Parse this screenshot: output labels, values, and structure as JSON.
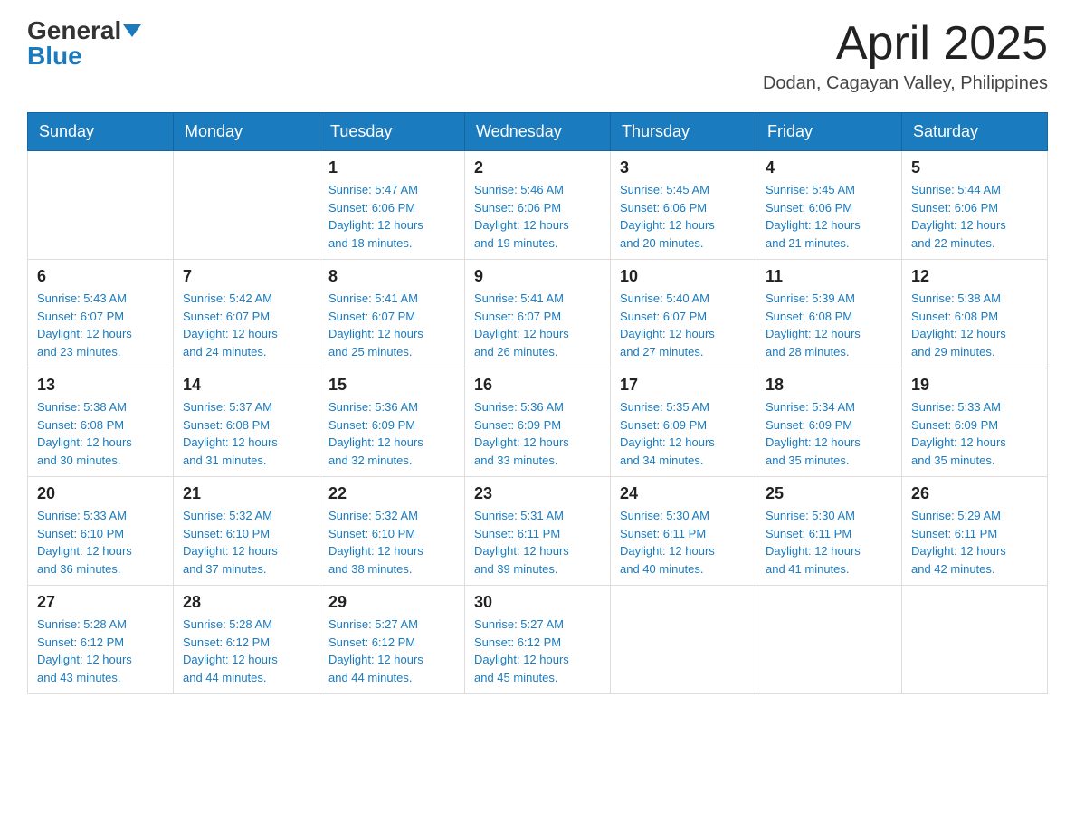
{
  "header": {
    "logo": {
      "general": "General",
      "blue": "Blue"
    },
    "title": "April 2025",
    "location": "Dodan, Cagayan Valley, Philippines"
  },
  "weekdays": [
    "Sunday",
    "Monday",
    "Tuesday",
    "Wednesday",
    "Thursday",
    "Friday",
    "Saturday"
  ],
  "weeks": [
    [
      {
        "day": "",
        "info": ""
      },
      {
        "day": "",
        "info": ""
      },
      {
        "day": "1",
        "info": "Sunrise: 5:47 AM\nSunset: 6:06 PM\nDaylight: 12 hours\nand 18 minutes."
      },
      {
        "day": "2",
        "info": "Sunrise: 5:46 AM\nSunset: 6:06 PM\nDaylight: 12 hours\nand 19 minutes."
      },
      {
        "day": "3",
        "info": "Sunrise: 5:45 AM\nSunset: 6:06 PM\nDaylight: 12 hours\nand 20 minutes."
      },
      {
        "day": "4",
        "info": "Sunrise: 5:45 AM\nSunset: 6:06 PM\nDaylight: 12 hours\nand 21 minutes."
      },
      {
        "day": "5",
        "info": "Sunrise: 5:44 AM\nSunset: 6:06 PM\nDaylight: 12 hours\nand 22 minutes."
      }
    ],
    [
      {
        "day": "6",
        "info": "Sunrise: 5:43 AM\nSunset: 6:07 PM\nDaylight: 12 hours\nand 23 minutes."
      },
      {
        "day": "7",
        "info": "Sunrise: 5:42 AM\nSunset: 6:07 PM\nDaylight: 12 hours\nand 24 minutes."
      },
      {
        "day": "8",
        "info": "Sunrise: 5:41 AM\nSunset: 6:07 PM\nDaylight: 12 hours\nand 25 minutes."
      },
      {
        "day": "9",
        "info": "Sunrise: 5:41 AM\nSunset: 6:07 PM\nDaylight: 12 hours\nand 26 minutes."
      },
      {
        "day": "10",
        "info": "Sunrise: 5:40 AM\nSunset: 6:07 PM\nDaylight: 12 hours\nand 27 minutes."
      },
      {
        "day": "11",
        "info": "Sunrise: 5:39 AM\nSunset: 6:08 PM\nDaylight: 12 hours\nand 28 minutes."
      },
      {
        "day": "12",
        "info": "Sunrise: 5:38 AM\nSunset: 6:08 PM\nDaylight: 12 hours\nand 29 minutes."
      }
    ],
    [
      {
        "day": "13",
        "info": "Sunrise: 5:38 AM\nSunset: 6:08 PM\nDaylight: 12 hours\nand 30 minutes."
      },
      {
        "day": "14",
        "info": "Sunrise: 5:37 AM\nSunset: 6:08 PM\nDaylight: 12 hours\nand 31 minutes."
      },
      {
        "day": "15",
        "info": "Sunrise: 5:36 AM\nSunset: 6:09 PM\nDaylight: 12 hours\nand 32 minutes."
      },
      {
        "day": "16",
        "info": "Sunrise: 5:36 AM\nSunset: 6:09 PM\nDaylight: 12 hours\nand 33 minutes."
      },
      {
        "day": "17",
        "info": "Sunrise: 5:35 AM\nSunset: 6:09 PM\nDaylight: 12 hours\nand 34 minutes."
      },
      {
        "day": "18",
        "info": "Sunrise: 5:34 AM\nSunset: 6:09 PM\nDaylight: 12 hours\nand 35 minutes."
      },
      {
        "day": "19",
        "info": "Sunrise: 5:33 AM\nSunset: 6:09 PM\nDaylight: 12 hours\nand 35 minutes."
      }
    ],
    [
      {
        "day": "20",
        "info": "Sunrise: 5:33 AM\nSunset: 6:10 PM\nDaylight: 12 hours\nand 36 minutes."
      },
      {
        "day": "21",
        "info": "Sunrise: 5:32 AM\nSunset: 6:10 PM\nDaylight: 12 hours\nand 37 minutes."
      },
      {
        "day": "22",
        "info": "Sunrise: 5:32 AM\nSunset: 6:10 PM\nDaylight: 12 hours\nand 38 minutes."
      },
      {
        "day": "23",
        "info": "Sunrise: 5:31 AM\nSunset: 6:11 PM\nDaylight: 12 hours\nand 39 minutes."
      },
      {
        "day": "24",
        "info": "Sunrise: 5:30 AM\nSunset: 6:11 PM\nDaylight: 12 hours\nand 40 minutes."
      },
      {
        "day": "25",
        "info": "Sunrise: 5:30 AM\nSunset: 6:11 PM\nDaylight: 12 hours\nand 41 minutes."
      },
      {
        "day": "26",
        "info": "Sunrise: 5:29 AM\nSunset: 6:11 PM\nDaylight: 12 hours\nand 42 minutes."
      }
    ],
    [
      {
        "day": "27",
        "info": "Sunrise: 5:28 AM\nSunset: 6:12 PM\nDaylight: 12 hours\nand 43 minutes."
      },
      {
        "day": "28",
        "info": "Sunrise: 5:28 AM\nSunset: 6:12 PM\nDaylight: 12 hours\nand 44 minutes."
      },
      {
        "day": "29",
        "info": "Sunrise: 5:27 AM\nSunset: 6:12 PM\nDaylight: 12 hours\nand 44 minutes."
      },
      {
        "day": "30",
        "info": "Sunrise: 5:27 AM\nSunset: 6:12 PM\nDaylight: 12 hours\nand 45 minutes."
      },
      {
        "day": "",
        "info": ""
      },
      {
        "day": "",
        "info": ""
      },
      {
        "day": "",
        "info": ""
      }
    ]
  ]
}
